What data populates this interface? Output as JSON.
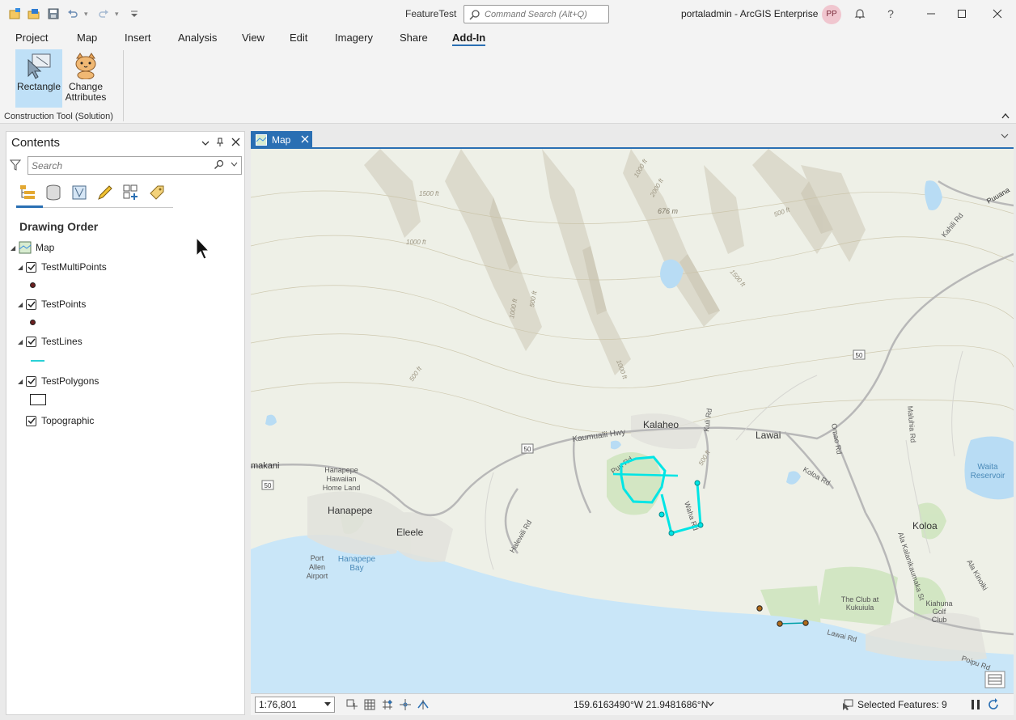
{
  "window": {
    "title": "FeatureTest",
    "command_search_placeholder": "Command Search (Alt+Q)",
    "portal": "portaladmin - ArcGIS Enterprise",
    "avatar_initials": "PP",
    "help_glyph": "?"
  },
  "ribbon": {
    "tabs": [
      "Project",
      "Map",
      "Insert",
      "Analysis",
      "View",
      "Edit",
      "Imagery",
      "Share",
      "Add-In"
    ],
    "active_tab": "Add-In",
    "buttons": [
      {
        "label_line1": "Rectangle",
        "label_line2": "",
        "selected": true
      },
      {
        "label_line1": "Change",
        "label_line2": "Attributes",
        "selected": false
      }
    ],
    "group_label": "Construction Tool (Solution)"
  },
  "contents": {
    "title": "Contents",
    "search_placeholder": "Search",
    "drawing_order": "Drawing Order",
    "map_name": "Map",
    "layers": [
      {
        "name": "TestMultiPoints",
        "symbol": "point",
        "checked": true
      },
      {
        "name": "TestPoints",
        "symbol": "point",
        "checked": true
      },
      {
        "name": "TestLines",
        "symbol": "line",
        "checked": true
      },
      {
        "name": "TestPolygons",
        "symbol": "polygon",
        "checked": true
      },
      {
        "name": "Topographic",
        "symbol": "none",
        "checked": true
      }
    ]
  },
  "map_view": {
    "tab_label": "Map",
    "place_labels": {
      "kalaheo": "Kalaheo",
      "lawai": "Lawai",
      "hanapepe": "Hanapepe",
      "eleele": "Eleele",
      "koloa": "Koloa",
      "makani": "makani",
      "hanapepe_homeland": [
        "Hanapepe",
        "Hawaiian",
        "Home Land"
      ],
      "port_allen": [
        "Port",
        "Allen",
        "Airport"
      ],
      "hanapepe_bay": [
        "Hanapepe",
        "Bay"
      ],
      "waita": [
        "Waita",
        "Reservoir"
      ],
      "club": [
        "The Club at",
        "Kukuiula"
      ],
      "kiahuna": [
        "Kiahuna",
        "Golf",
        "Club"
      ],
      "puuana": "Puuana"
    },
    "road_labels": {
      "kaumualii": "Kaumualii Hwy",
      "puu_rd": "Puu Rd",
      "kuli_rd": "Kuli Rd",
      "waha_rd": "Waha Rd",
      "halewili": "Halewili Rd",
      "koloa_rd": "Koloa Rd",
      "omao_rd": "Omao Rd",
      "maluhia": "Maluhia Rd",
      "alakalanikaumaka": "Ala Kalanikaumaka St",
      "ala_kinoiki": "Ala Kinoiki",
      "lawai_rd": "Lawai Rd",
      "poipu_rd": "Poipu Rd",
      "kahili": "Kahili Rd"
    },
    "route_shields": [
      "50",
      "50",
      "50",
      "50"
    ],
    "contour_labels": [
      "1500 ft",
      "2000 ft",
      "1000 ft",
      "676 m",
      "1000 ft",
      "1500 ft",
      "1000 ft",
      "500 ft",
      "500 ft",
      "1000 ft",
      "500 ft",
      "500 ft"
    ]
  },
  "status": {
    "scale": "1:76,801",
    "coordinates": "159.6163490°W 21.9481686°N",
    "selected_features": "Selected Features: 9"
  },
  "colors": {
    "accent": "#2a6fb3",
    "selection": "#00e5e5",
    "water": "#b8dcf4",
    "ocean": "#c9e6f8"
  }
}
